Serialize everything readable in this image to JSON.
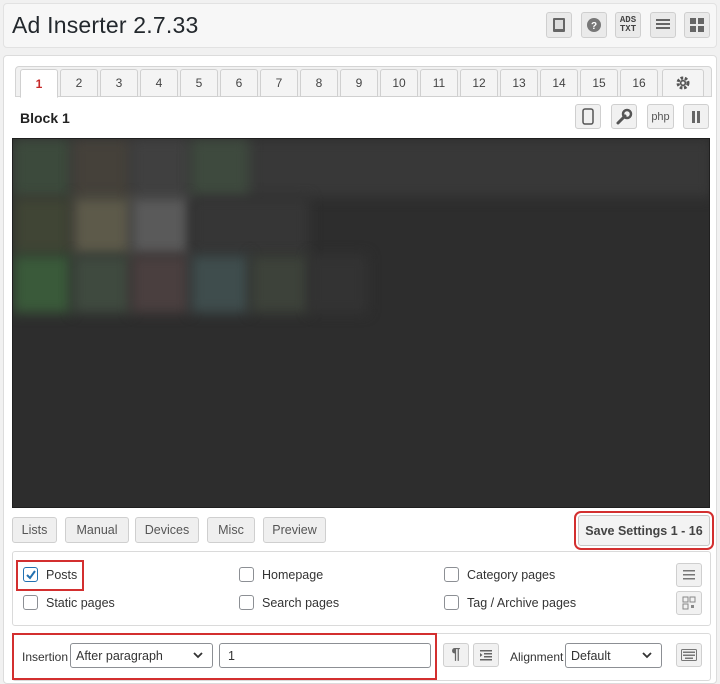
{
  "header": {
    "title": "Ad Inserter 2.7.33",
    "icons": [
      "book-icon",
      "help-icon",
      "ads-txt-icon",
      "list-icon",
      "blocks-icon"
    ],
    "ads_txt_line1": "ADS",
    "ads_txt_line2": "TXT"
  },
  "tabs": {
    "items": [
      "1",
      "2",
      "3",
      "4",
      "5",
      "6",
      "7",
      "8",
      "9",
      "10",
      "11",
      "12",
      "13",
      "14",
      "15",
      "16"
    ],
    "active": "1",
    "settings_icon": "gear-icon"
  },
  "block": {
    "title": "Block 1",
    "php_label": "php"
  },
  "bottom_buttons": {
    "lists": "Lists",
    "manual": "Manual",
    "devices": "Devices",
    "misc": "Misc",
    "preview": "Preview",
    "save": "Save Settings 1 - 16"
  },
  "automatic_insertion": {
    "posts": {
      "label": "Posts",
      "checked": true
    },
    "homepage": {
      "label": "Homepage",
      "checked": false
    },
    "category_pages": {
      "label": "Category pages",
      "checked": false
    },
    "static_pages": {
      "label": "Static pages",
      "checked": false
    },
    "search_pages": {
      "label": "Search pages",
      "checked": false
    },
    "tag_archive_pages": {
      "label": "Tag / Archive pages",
      "checked": false
    }
  },
  "insertion": {
    "label": "Insertion",
    "value": "After paragraph",
    "paragraph_number": "1",
    "alignment_label": "Alignment",
    "alignment_value": "Default"
  },
  "colors": {
    "accent_red": "#d32f2f",
    "checkbox_blue": "#2271b1",
    "editor_bg": "#2d2d2d"
  }
}
